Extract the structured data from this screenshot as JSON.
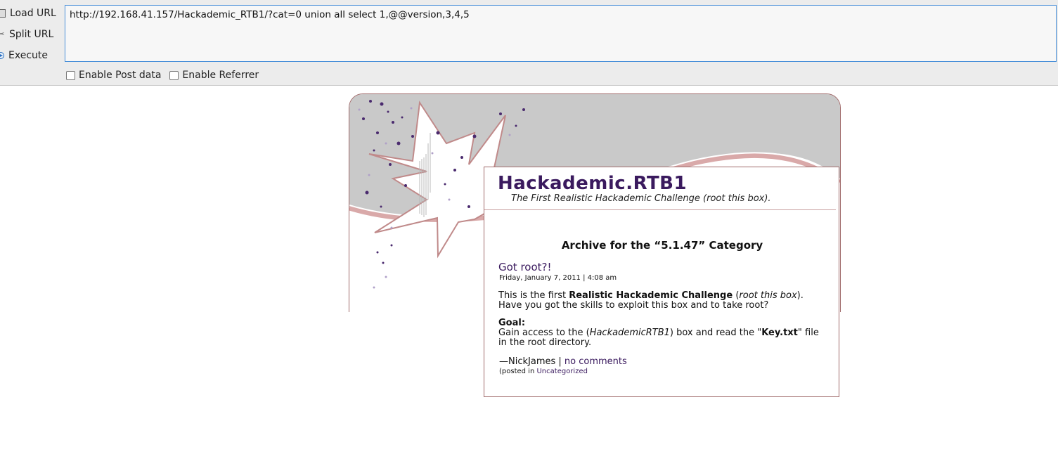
{
  "hackbar": {
    "load_url": "Load URL",
    "split_url": "Split URL",
    "execute": "Execute",
    "url_value": "http://192.168.41.157/Hackademic_RTB1/?cat=0 union all select 1,@@version,3,4,5",
    "enable_post": "Enable Post data",
    "enable_referrer": "Enable Referrer"
  },
  "page": {
    "site_title": "Hackademic.RTB1",
    "site_description": "The First Realistic Hackademic Challenge (root this box).",
    "archive_title": "Archive for the “5.1.47” Category",
    "post": {
      "title": "Got root?!",
      "date": "Friday, January 7, 2011 | 4:08 am",
      "p1_prefix": "This is the first ",
      "p1_bold": "Realistic Hackademic Challenge",
      "p1_mid": " (",
      "p1_italic": "root this box",
      "p1_suffix": ").",
      "p1_line2": "Have you got the skills to exploit this box and to take root?",
      "goal_label": "Goal:",
      "goal_prefix": "Gain access to the (",
      "goal_italic": "HackademicRTB1",
      "goal_mid": ") box and read the \"",
      "goal_bold": "Key.txt",
      "goal_suffix": "\" file in the root directory.",
      "author": "—NickJames | ",
      "comments_link": "no comments",
      "posted_prefix": "(posted in ",
      "category_link": "Uncategorized"
    }
  },
  "colors": {
    "title": "#3a1a5e",
    "border": "#a06a6a",
    "url_focus": "#4a90d9"
  }
}
